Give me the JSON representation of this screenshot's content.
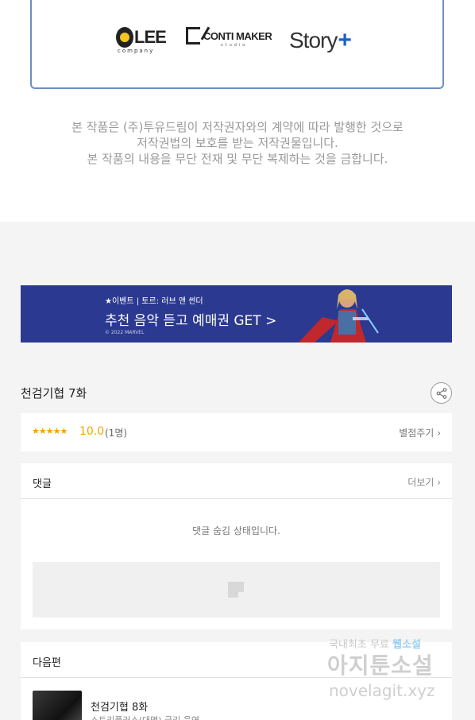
{
  "logos": {
    "lee": "LEE",
    "lee_sub": "company",
    "conti": "CONTI MAKER",
    "conti_sub": "studio",
    "story": "Story",
    "story_plus": "+"
  },
  "copyright": {
    "line1": "본 작품은 (주)투유드림이 저작권자와의 계약에 따라 발행한 것으로",
    "line2": "저작권법의 보호를 받는 저작권물입니다.",
    "line3": "본 작품의 내용을 무단 전재 및 무단 복제하는 것을 금합니다."
  },
  "banner": {
    "small": "★이벤트 | 토르: 러브 앤 썬더",
    "big": "추천 음악 듣고 예매권 GET >",
    "copy": "© 2022 MARVEL",
    "bg_color": "#2b3990"
  },
  "episode": {
    "title": "천검기협 7화",
    "share_icon": "share-icon"
  },
  "rating": {
    "stars": "★★★★★",
    "score": "10.0",
    "count": "(1명)",
    "rate_link": "별점주기",
    "star_color": "#f0a500"
  },
  "comments": {
    "title": "댓글",
    "more": "더보기",
    "hidden_message": "댓글 숨김 상태입니다."
  },
  "next": {
    "title": "다음편",
    "episode_title": "천검기협 8화",
    "episode_sub": "스토리플러스(대명) 글리 음연"
  },
  "watermark": {
    "line1_a": "국내최초 무료 ",
    "line1_b": "웹소설",
    "line2": "아지툰소설",
    "line3": "novelagit.xyz"
  }
}
